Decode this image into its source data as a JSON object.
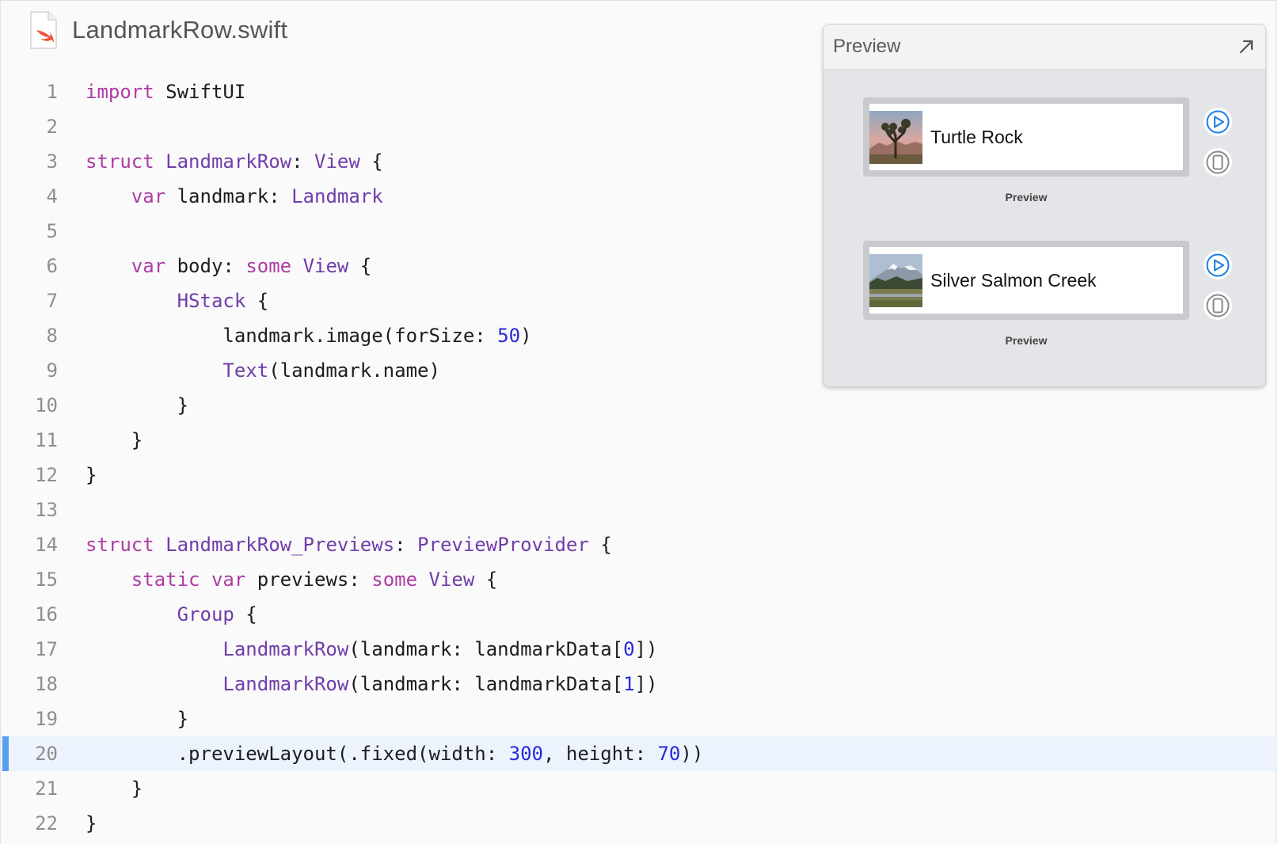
{
  "file": {
    "name": "LandmarkRow.swift",
    "icon": "swift-file-icon"
  },
  "colors": {
    "keyword": "#ad3da4",
    "type": "#703daa",
    "number": "#272ad8",
    "plain": "#1d1d1f",
    "line_number": "#8e8e8e",
    "highlight_bar": "#5aa0f0",
    "highlight_bg": "#ecf3fd",
    "preview_accent": "#1a7ce8"
  },
  "editor": {
    "highlighted_line": 20,
    "lines": [
      {
        "n": "1",
        "tokens": [
          {
            "t": "import",
            "c": "kw"
          },
          {
            "t": " SwiftUI",
            "c": "pl"
          }
        ]
      },
      {
        "n": "2",
        "tokens": []
      },
      {
        "n": "3",
        "tokens": [
          {
            "t": "struct",
            "c": "kw"
          },
          {
            "t": " ",
            "c": "pl"
          },
          {
            "t": "LandmarkRow",
            "c": "ty"
          },
          {
            "t": ": ",
            "c": "pl"
          },
          {
            "t": "View",
            "c": "ty"
          },
          {
            "t": " {",
            "c": "pl"
          }
        ]
      },
      {
        "n": "4",
        "tokens": [
          {
            "t": "    ",
            "c": "pl"
          },
          {
            "t": "var",
            "c": "kw"
          },
          {
            "t": " landmark: ",
            "c": "pl"
          },
          {
            "t": "Landmark",
            "c": "ty"
          }
        ]
      },
      {
        "n": "5",
        "tokens": []
      },
      {
        "n": "6",
        "tokens": [
          {
            "t": "    ",
            "c": "pl"
          },
          {
            "t": "var",
            "c": "kw"
          },
          {
            "t": " body: ",
            "c": "pl"
          },
          {
            "t": "some",
            "c": "kw"
          },
          {
            "t": " ",
            "c": "pl"
          },
          {
            "t": "View",
            "c": "ty"
          },
          {
            "t": " {",
            "c": "pl"
          }
        ]
      },
      {
        "n": "7",
        "tokens": [
          {
            "t": "        ",
            "c": "pl"
          },
          {
            "t": "HStack",
            "c": "ty"
          },
          {
            "t": " {",
            "c": "pl"
          }
        ]
      },
      {
        "n": "8",
        "tokens": [
          {
            "t": "            landmark.image(forSize: ",
            "c": "pl"
          },
          {
            "t": "50",
            "c": "nu"
          },
          {
            "t": ")",
            "c": "pl"
          }
        ]
      },
      {
        "n": "9",
        "tokens": [
          {
            "t": "            ",
            "c": "pl"
          },
          {
            "t": "Text",
            "c": "ty"
          },
          {
            "t": "(landmark.name)",
            "c": "pl"
          }
        ]
      },
      {
        "n": "10",
        "tokens": [
          {
            "t": "        }",
            "c": "pl"
          }
        ]
      },
      {
        "n": "11",
        "tokens": [
          {
            "t": "    }",
            "c": "pl"
          }
        ]
      },
      {
        "n": "12",
        "tokens": [
          {
            "t": "}",
            "c": "pl"
          }
        ]
      },
      {
        "n": "13",
        "tokens": []
      },
      {
        "n": "14",
        "tokens": [
          {
            "t": "struct",
            "c": "kw"
          },
          {
            "t": " ",
            "c": "pl"
          },
          {
            "t": "LandmarkRow_Previews",
            "c": "ty"
          },
          {
            "t": ": ",
            "c": "pl"
          },
          {
            "t": "PreviewProvider",
            "c": "ty"
          },
          {
            "t": " {",
            "c": "pl"
          }
        ]
      },
      {
        "n": "15",
        "tokens": [
          {
            "t": "    ",
            "c": "pl"
          },
          {
            "t": "static",
            "c": "kw"
          },
          {
            "t": " ",
            "c": "pl"
          },
          {
            "t": "var",
            "c": "kw"
          },
          {
            "t": " previews: ",
            "c": "pl"
          },
          {
            "t": "some",
            "c": "kw"
          },
          {
            "t": " ",
            "c": "pl"
          },
          {
            "t": "View",
            "c": "ty"
          },
          {
            "t": " {",
            "c": "pl"
          }
        ]
      },
      {
        "n": "16",
        "tokens": [
          {
            "t": "        ",
            "c": "pl"
          },
          {
            "t": "Group",
            "c": "ty"
          },
          {
            "t": " {",
            "c": "pl"
          }
        ]
      },
      {
        "n": "17",
        "tokens": [
          {
            "t": "            ",
            "c": "pl"
          },
          {
            "t": "LandmarkRow",
            "c": "ty"
          },
          {
            "t": "(landmark: landmarkData[",
            "c": "pl"
          },
          {
            "t": "0",
            "c": "nu"
          },
          {
            "t": "])",
            "c": "pl"
          }
        ]
      },
      {
        "n": "18",
        "tokens": [
          {
            "t": "            ",
            "c": "pl"
          },
          {
            "t": "LandmarkRow",
            "c": "ty"
          },
          {
            "t": "(landmark: landmarkData[",
            "c": "pl"
          },
          {
            "t": "1",
            "c": "nu"
          },
          {
            "t": "])",
            "c": "pl"
          }
        ]
      },
      {
        "n": "19",
        "tokens": [
          {
            "t": "        }",
            "c": "pl"
          }
        ]
      },
      {
        "n": "20",
        "tokens": [
          {
            "t": "        .previewLayout(.fixed(width: ",
            "c": "pl"
          },
          {
            "t": "300",
            "c": "nu"
          },
          {
            "t": ", height: ",
            "c": "pl"
          },
          {
            "t": "70",
            "c": "nu"
          },
          {
            "t": "))",
            "c": "pl"
          }
        ]
      },
      {
        "n": "21",
        "tokens": [
          {
            "t": "    }",
            "c": "pl"
          }
        ]
      },
      {
        "n": "22",
        "tokens": [
          {
            "t": "}",
            "c": "pl"
          }
        ]
      }
    ]
  },
  "preview": {
    "title": "Preview",
    "expand_icon": "expand-arrow-icon",
    "items": [
      {
        "name": "Turtle Rock",
        "caption": "Preview",
        "thumbnail": "desert-joshua-tree-thumbnail",
        "live_icon": "play-circle-icon",
        "device_icon": "device-icon"
      },
      {
        "name": "Silver Salmon Creek",
        "caption": "Preview",
        "thumbnail": "mountain-meadow-thumbnail",
        "live_icon": "play-circle-icon",
        "device_icon": "device-icon"
      }
    ]
  }
}
